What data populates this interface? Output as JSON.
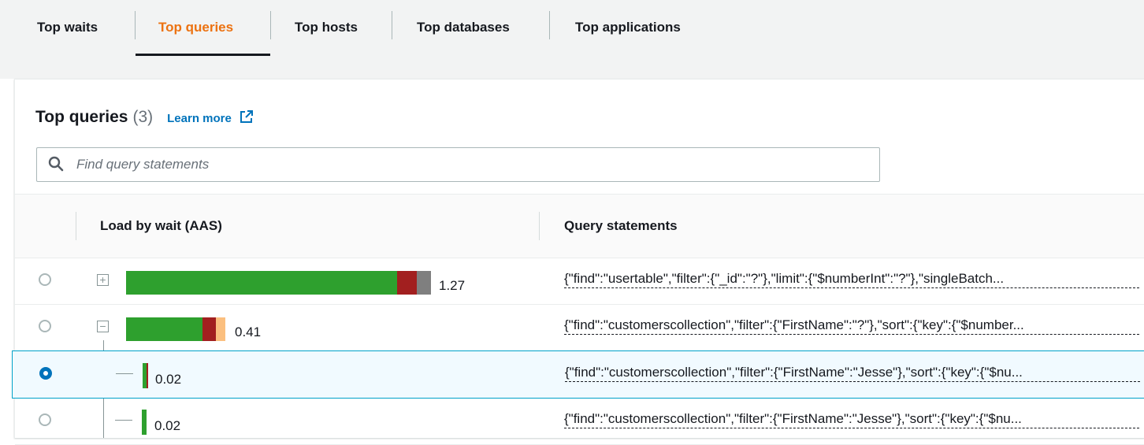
{
  "tabs": [
    {
      "label": "Top waits"
    },
    {
      "label": "Top queries"
    },
    {
      "label": "Top hosts"
    },
    {
      "label": "Top databases"
    },
    {
      "label": "Top applications"
    }
  ],
  "panel": {
    "title": "Top queries",
    "count": "(3)",
    "learn_more": "Learn more"
  },
  "search": {
    "placeholder": "Find query statements",
    "value": ""
  },
  "table": {
    "headers": {
      "load": "Load by wait (AAS)",
      "query": "Query statements"
    },
    "colors": {
      "cpu": "#2ea02e",
      "wait1": "#a21f1f",
      "wait2": "#7f7f7f",
      "wait3": "#fbbf7f"
    },
    "rows": [
      {
        "value": "1.27",
        "query": "{\"find\":\"usertable\",\"filter\":{\"_id\":\"?\"},\"limit\":{\"$numberInt\":\"?\"},\"singleBatch...",
        "selected": false
      },
      {
        "value": "0.41",
        "query": "{\"find\":\"customerscollection\",\"filter\":{\"FirstName\":\"?\"},\"sort\":{\"key\":{\"$number...",
        "selected": false
      },
      {
        "value": "0.02",
        "query": "{\"find\":\"customerscollection\",\"filter\":{\"FirstName\":\"Jesse\"},\"sort\":{\"key\":{\"$nu...",
        "selected": true
      },
      {
        "value": "0.02",
        "query": "{\"find\":\"customerscollection\",\"filter\":{\"FirstName\":\"Jesse\"},\"sort\":{\"key\":{\"$nu...",
        "selected": false
      }
    ]
  }
}
